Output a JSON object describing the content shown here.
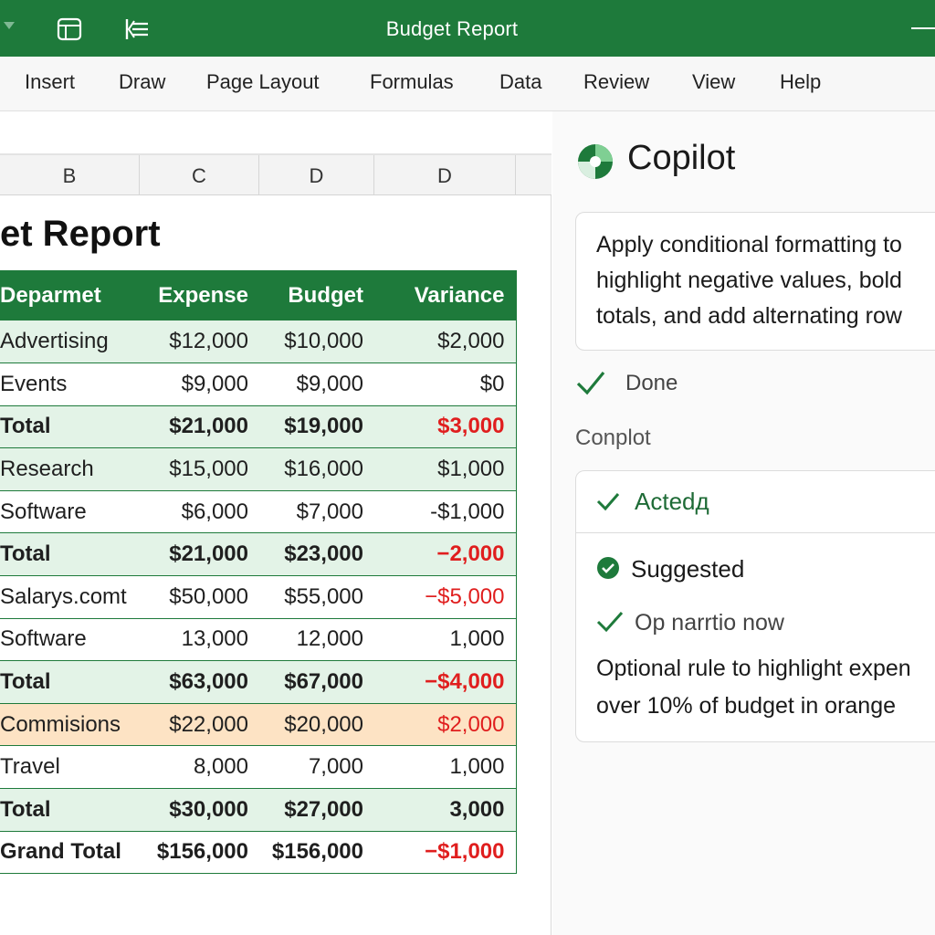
{
  "window": {
    "title": "Budget Report"
  },
  "ribbon": {
    "tabs": [
      "Insert",
      "Draw",
      "Page Layout",
      "Formulas",
      "Data",
      "Review",
      "View",
      "Help"
    ]
  },
  "columns": [
    "B",
    "C",
    "D",
    "D"
  ],
  "sheet": {
    "title": "et Report",
    "headers": {
      "dept": "Deparmet",
      "expense": "Expense",
      "budget": "Budget",
      "variance": "Variance"
    },
    "rows": [
      {
        "dept": "Advertising",
        "expense": "$12,000",
        "budget": "$10,000",
        "variance": "$2,000",
        "style": "tint",
        "total": false,
        "neg": false
      },
      {
        "dept": "Events",
        "expense": "$9,000",
        "budget": "$9,000",
        "variance": "$0",
        "style": "plain",
        "total": false,
        "neg": false
      },
      {
        "dept": "Total",
        "expense": "$21,000",
        "budget": "$19,000",
        "variance": "$3,000",
        "style": "tint",
        "total": true,
        "neg": true
      },
      {
        "dept": "Research",
        "expense": "$15,000",
        "budget": "$16,000",
        "variance": "$1,000",
        "style": "tint",
        "total": false,
        "neg": false
      },
      {
        "dept": "Software",
        "expense": "$6,000",
        "budget": "$7,000",
        "variance": "-$1,000",
        "style": "plain",
        "total": false,
        "neg": false
      },
      {
        "dept": "Total",
        "expense": "$21,000",
        "budget": "$23,000",
        "variance": "−2,000",
        "style": "tint",
        "total": true,
        "neg": true
      },
      {
        "dept": "Salarys.comt",
        "expense": "$50,000",
        "budget": "$55,000",
        "variance": "−$5,000",
        "style": "plain",
        "total": false,
        "neg": true
      },
      {
        "dept": "Software",
        "expense": "13,000",
        "budget": "12,000",
        "variance": "1,000",
        "style": "plain",
        "total": false,
        "neg": false
      },
      {
        "dept": "Total",
        "expense": "$63,000",
        "budget": "$67,000",
        "variance": "−$4,000",
        "style": "tint",
        "total": true,
        "neg": true
      },
      {
        "dept": "Commisions",
        "expense": "$22,000",
        "budget": "$20,000",
        "variance": "$2,000",
        "style": "orange",
        "total": false,
        "neg": true
      },
      {
        "dept": "Travel",
        "expense": "8,000",
        "budget": "7,000",
        "variance": "1,000",
        "style": "plain",
        "total": false,
        "neg": false
      },
      {
        "dept": "Total",
        "expense": "$30,000",
        "budget": "$27,000",
        "variance": "3,000",
        "style": "tint",
        "total": true,
        "neg": false
      },
      {
        "dept": "Grand Total",
        "expense": "$156,000",
        "budget": "$156,000",
        "variance": "−$1,000",
        "style": "plain",
        "total": true,
        "neg": true
      }
    ]
  },
  "copilot": {
    "title": "Copilot",
    "prompt_lines": [
      "Apply conditional formatting to",
      "highlight negative values, bold",
      "totals, and add alternating row"
    ],
    "done_label": "Done",
    "section_label": "Conplot",
    "acted_label": "Actedд",
    "suggested_label": "Suggested",
    "option_label": "Op narrtio now",
    "suggestion_lines": [
      "Optional rule to highlight expen",
      "over 10% of budget in orange"
    ]
  },
  "colors": {
    "accent": "#1e7a3b",
    "row_tint": "#e3f3e7",
    "row_highlight": "#fde3c4",
    "negative": "#e01e1e"
  },
  "icons": {
    "quick_access_1": "panel-icon",
    "quick_access_2": "list-indent-icon",
    "copilot_logo": "copilot-logo-icon",
    "status": "checkmark-icon"
  }
}
